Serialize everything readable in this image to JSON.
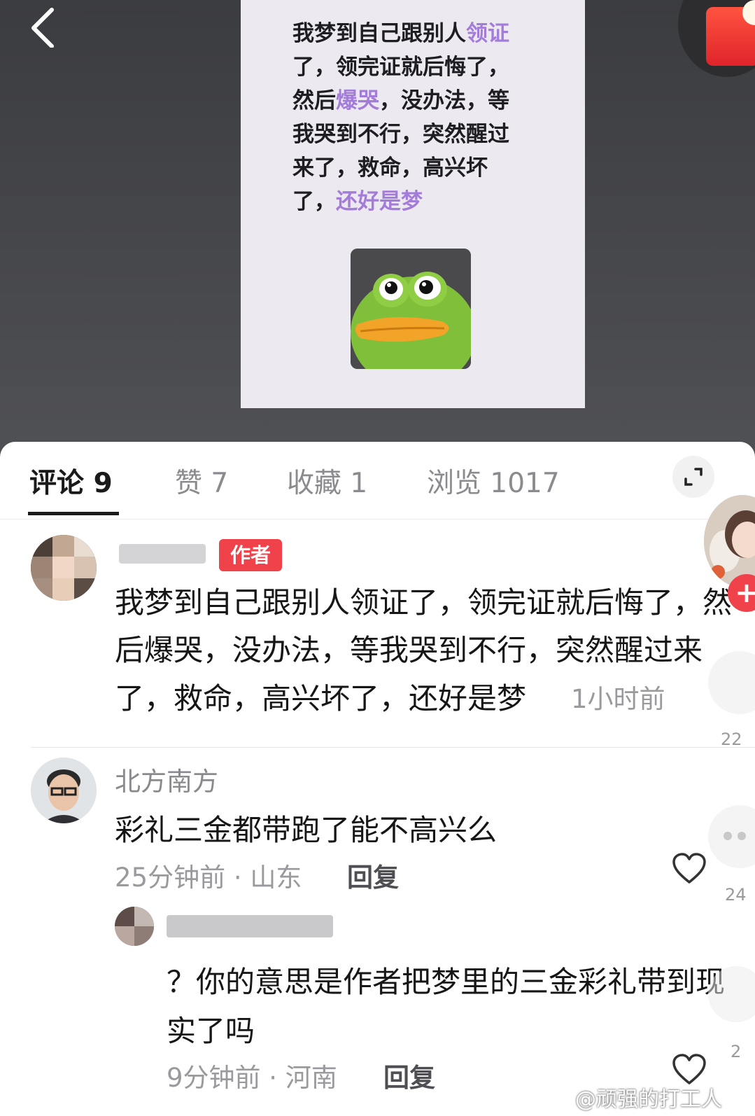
{
  "post": {
    "text_lines": [
      [
        {
          "t": "我梦到自己跟别人"
        },
        {
          "t": "领证",
          "hl": true
        }
      ],
      [
        {
          "t": "了，领完证就后悔了，"
        }
      ],
      [
        {
          "t": "然后"
        },
        {
          "t": "爆哭",
          "hl": true
        },
        {
          "t": "，没办法，等"
        }
      ],
      [
        {
          "t": "我哭到不行，突然醒过"
        }
      ],
      [
        {
          "t": "来了，救命，高兴坏"
        }
      ],
      [
        {
          "t": "了，"
        },
        {
          "t": "还好是梦",
          "hl": true
        }
      ]
    ],
    "highlight_color": "#a37bd8"
  },
  "tabs": {
    "comments": "评论 9",
    "likes": "赞 7",
    "favorites": "收藏 1",
    "views": "浏览 1017"
  },
  "comments": [
    {
      "author_badge": "作者",
      "text_lines": [
        "我梦到自己跟别人领证了，领完证就后悔了，然",
        "后爆哭，没办法，等我哭到不行，突然醒过来",
        "了，救命，高兴坏了，还好是梦"
      ],
      "time": "1小时前"
    },
    {
      "username": "北方南方",
      "text": "彩礼三金都带跑了能不高兴么",
      "meta": "25分钟前 · 山东",
      "reply_label": "回复",
      "replies": [
        {
          "text_lines": [
            "？你的意思是作者把梦里的三金彩礼带到现",
            "实了吗"
          ],
          "meta": "9分钟前 · 河南",
          "reply_label": "回复"
        }
      ]
    }
  ],
  "overlay_counts": [
    "22",
    "24",
    "2"
  ],
  "watermark": "@顽强的打工人",
  "colors": {
    "accent_red": "#f0424a",
    "text_primary": "#161616",
    "text_secondary": "#9a9a9e"
  }
}
